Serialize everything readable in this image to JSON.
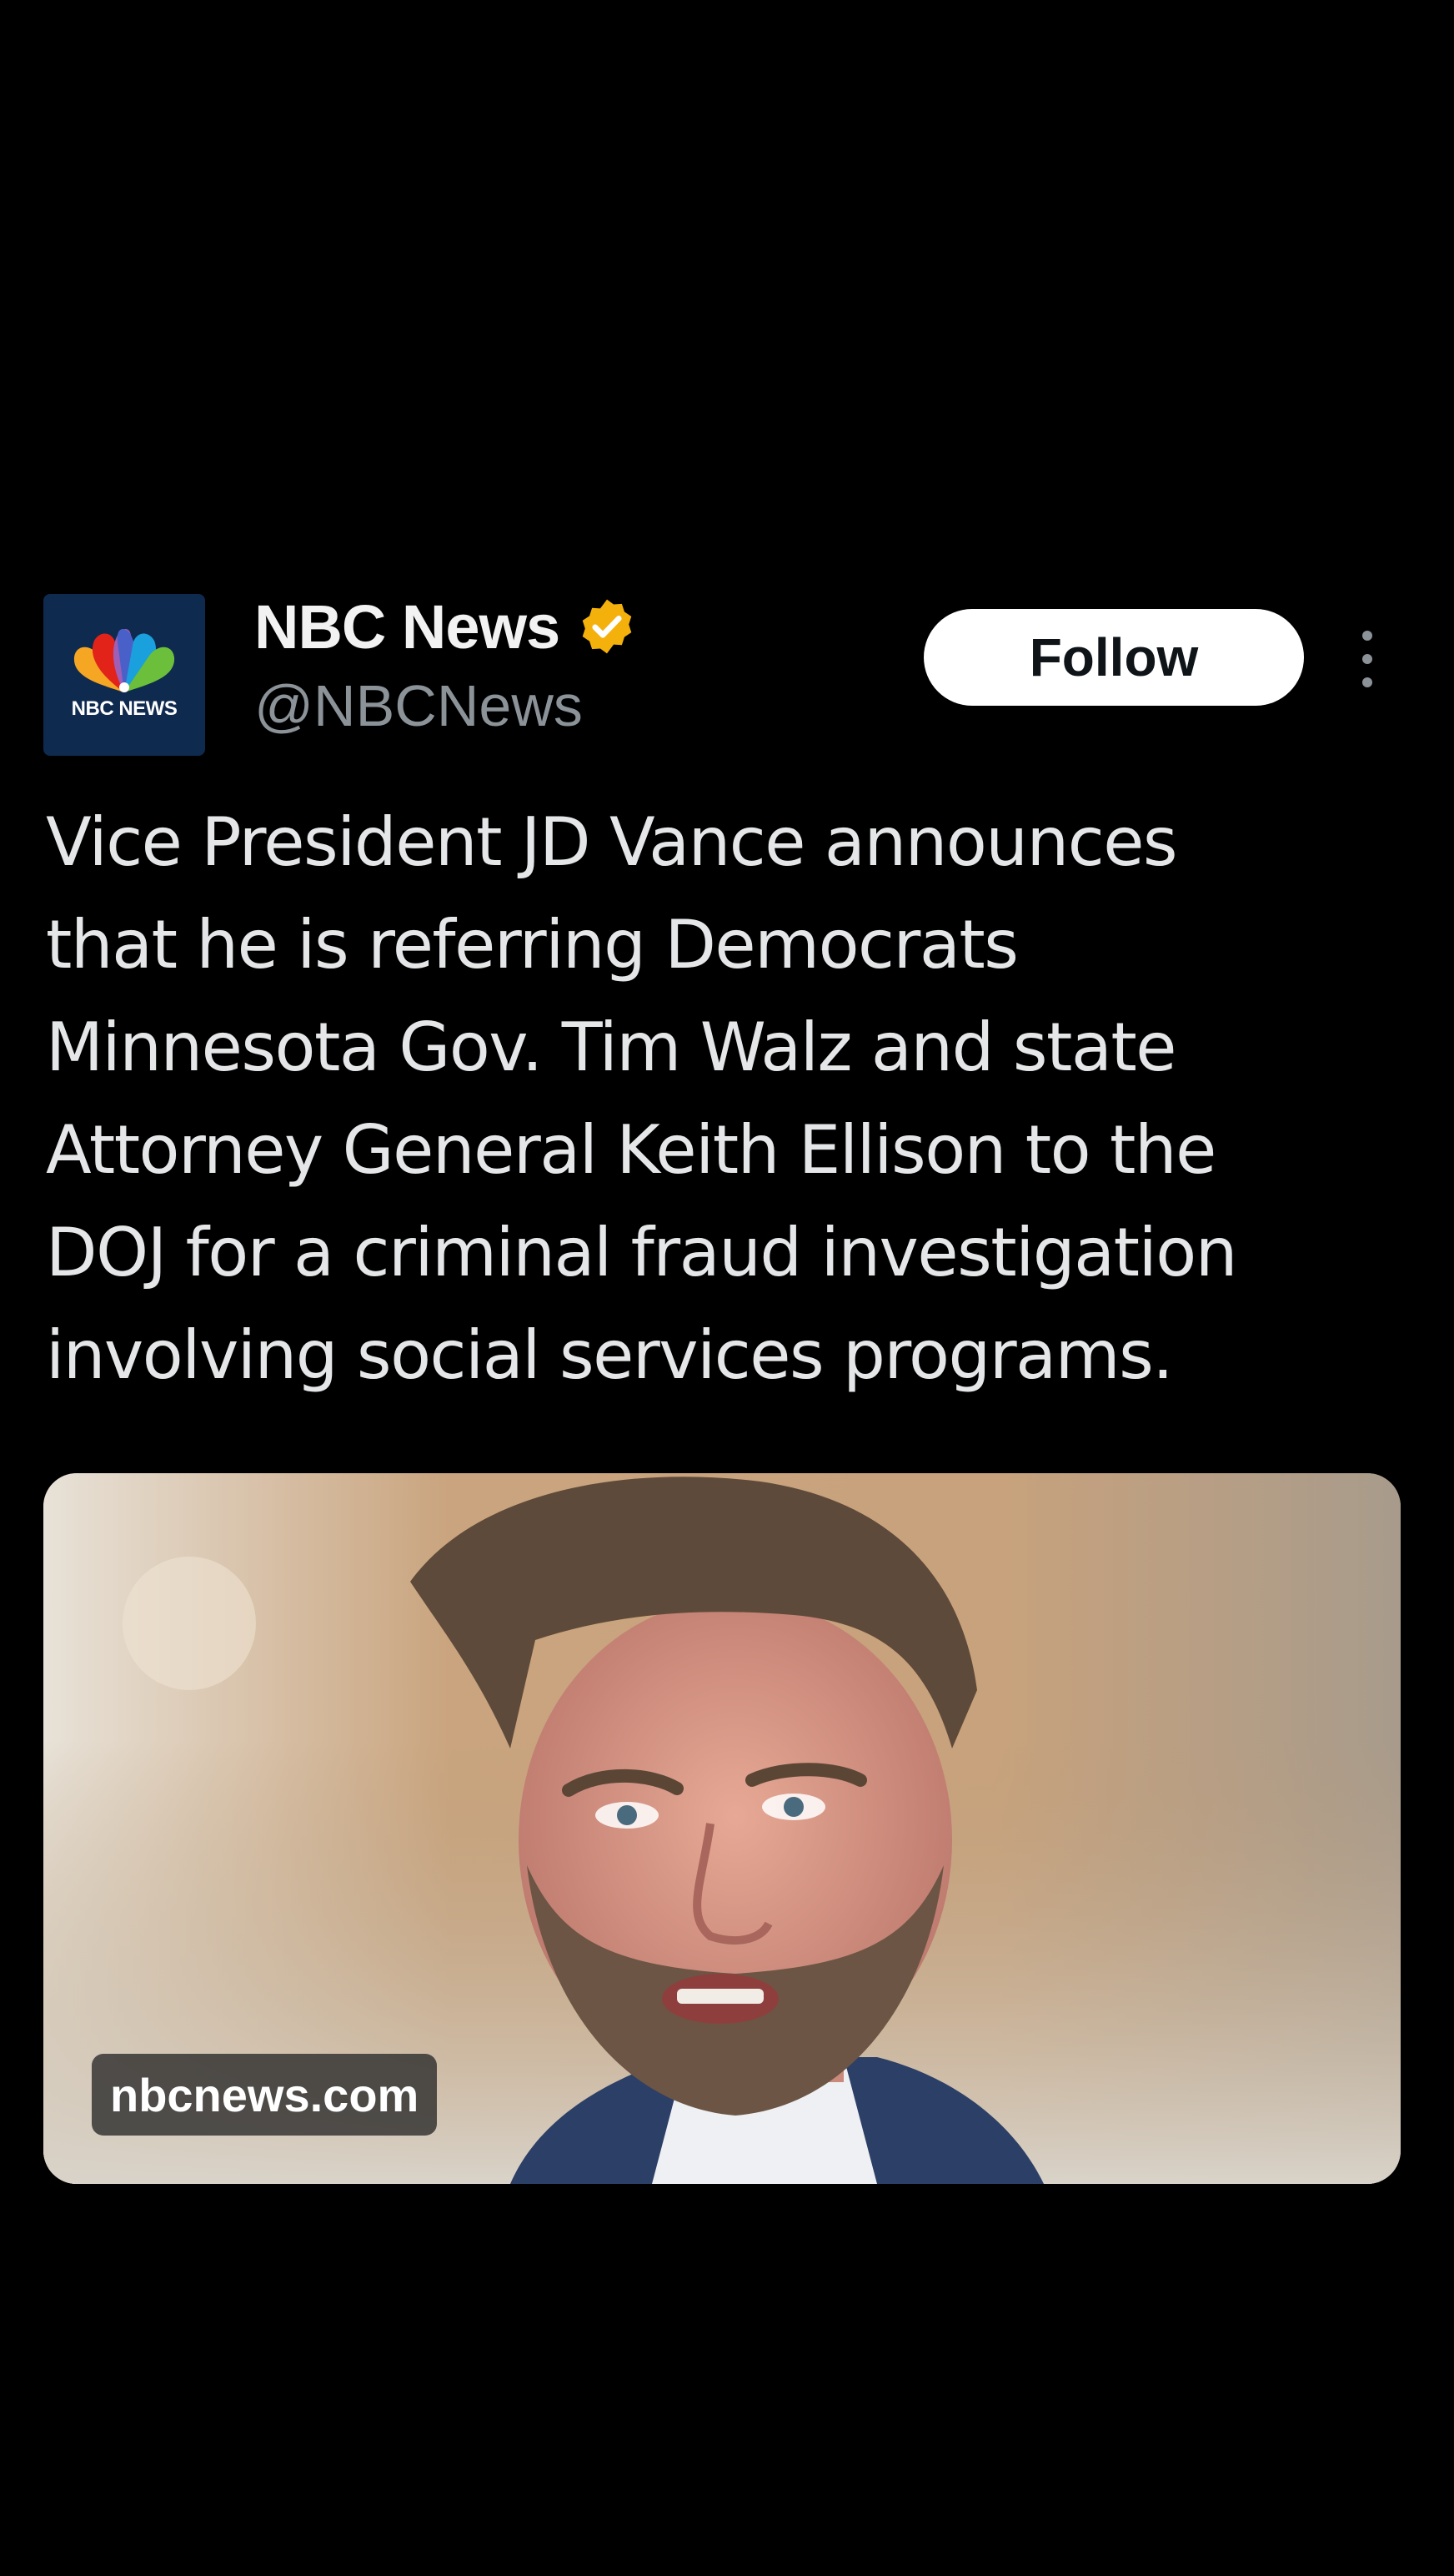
{
  "author": {
    "avatar_text": "NBC NEWS",
    "display_name": "NBC News",
    "handle": "@NBCNews",
    "verified_icon": "verified-badge-icon",
    "verified_color": "#f4b10b"
  },
  "actions": {
    "follow_label": "Follow",
    "more_icon": "more-vertical-icon"
  },
  "post": {
    "text": "Vice President JD Vance announces\nthat he is referring Democrats\nMinnesota Gov. Tim Walz and state\nAttorney General Keith Ellison  to the\nDOJ for a criminal fraud investigation\ninvolving social services programs."
  },
  "media": {
    "domain": "nbcnews.com"
  },
  "colors": {
    "background": "#000000",
    "text": "#e7e9ea",
    "secondary_text": "#8b9298",
    "follow_bg": "#ffffff"
  }
}
